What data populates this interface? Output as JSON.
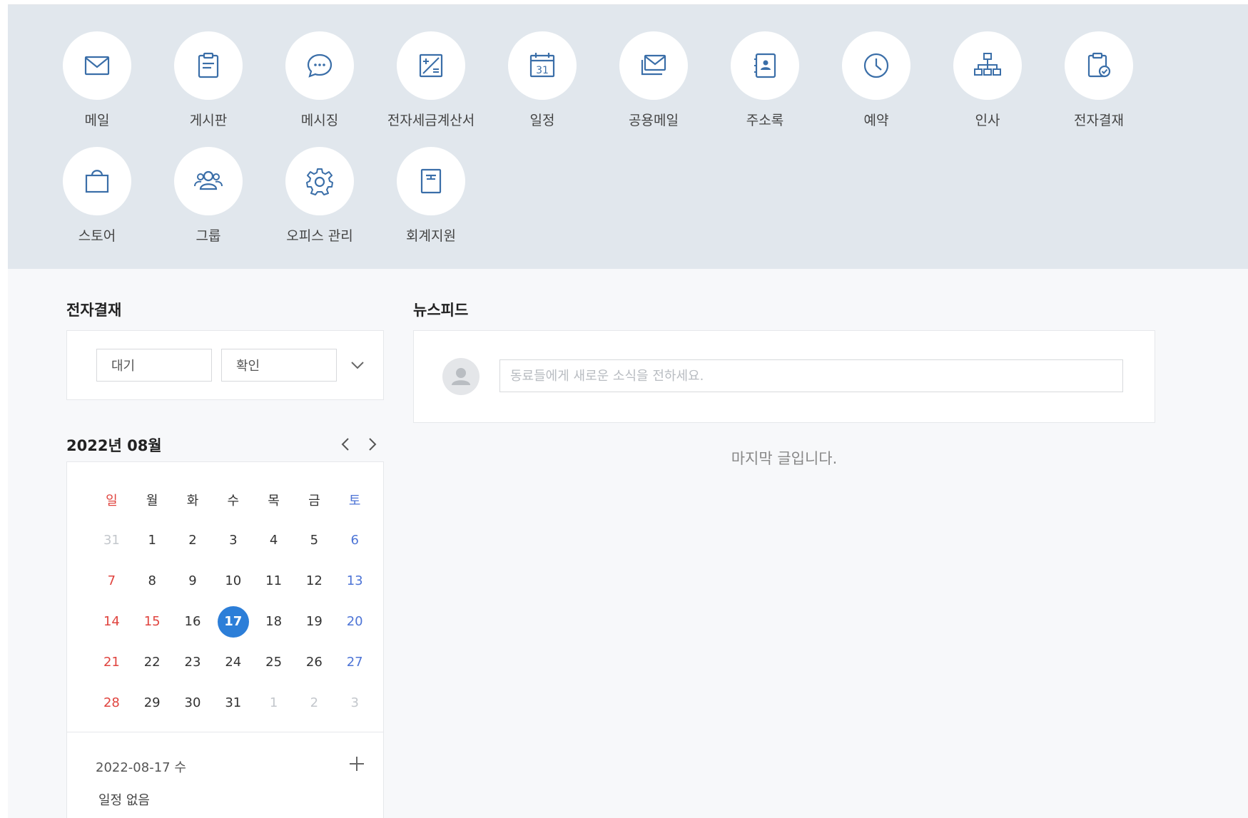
{
  "apps": [
    {
      "label": "메일",
      "icon": "mail-icon"
    },
    {
      "label": "게시판",
      "icon": "board-icon"
    },
    {
      "label": "메시징",
      "icon": "messaging-icon"
    },
    {
      "label": "전자세금계산서",
      "icon": "tax-invoice-icon"
    },
    {
      "label": "일정",
      "icon": "calendar-icon"
    },
    {
      "label": "공용메일",
      "icon": "shared-mail-icon"
    },
    {
      "label": "주소록",
      "icon": "address-book-icon"
    },
    {
      "label": "예약",
      "icon": "clock-icon"
    },
    {
      "label": "인사",
      "icon": "org-chart-icon"
    },
    {
      "label": "전자결재",
      "icon": "approval-icon"
    },
    {
      "label": "스토어",
      "icon": "store-bag-icon"
    },
    {
      "label": "그룹",
      "icon": "group-icon"
    },
    {
      "label": "오피스 관리",
      "icon": "gear-icon"
    },
    {
      "label": "회계지원",
      "icon": "accounting-icon"
    }
  ],
  "calendar_icon_day": "31",
  "approval": {
    "title": "전자결재",
    "tabs": [
      "대기",
      "확인"
    ]
  },
  "calendar": {
    "month_title": "2022년 08월",
    "weekdays": [
      "일",
      "월",
      "화",
      "수",
      "목",
      "금",
      "토"
    ],
    "weeks": [
      [
        "31",
        "1",
        "2",
        "3",
        "4",
        "5",
        "6"
      ],
      [
        "7",
        "8",
        "9",
        "10",
        "11",
        "12",
        "13"
      ],
      [
        "14",
        "15",
        "16",
        "17",
        "18",
        "19",
        "20"
      ],
      [
        "21",
        "22",
        "23",
        "24",
        "25",
        "26",
        "27"
      ],
      [
        "28",
        "29",
        "30",
        "31",
        "1",
        "2",
        "3"
      ]
    ],
    "selected": "17",
    "holiday": "15",
    "schedule_date": "2022-08-17 수",
    "schedule_empty": "일정 없음"
  },
  "newsfeed": {
    "title": "뉴스피드",
    "input_placeholder": "동료들에게 새로운 소식을 전하세요.",
    "last_post": "마지막 글입니다."
  },
  "colors": {
    "accent": "#2c7ed8",
    "icon": "#3a6ea8",
    "sunday": "#e0443f",
    "saturday": "#4d74d6",
    "apps_bg": "#e1e7ed"
  }
}
